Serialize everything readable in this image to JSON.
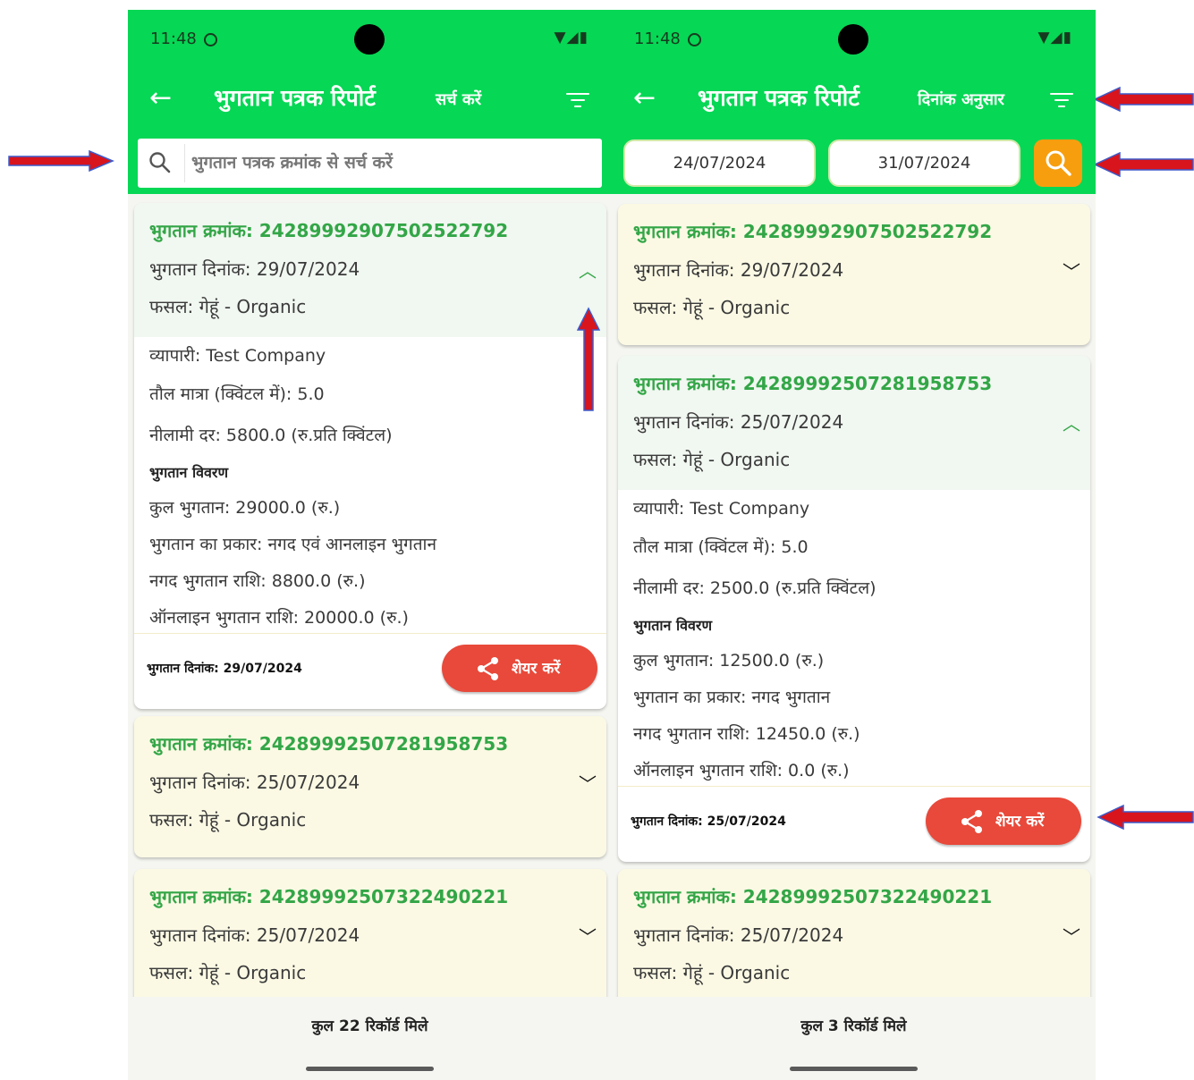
{
  "status_bar": {
    "time": "11:48",
    "icons": "▼◢▮"
  },
  "left_screen": {
    "title": "भुगतान पत्रक रिपोर्ट",
    "mode_label": "सर्च करें",
    "search_placeholder": "भुगतान पत्रक क्रमांक से सर्च करें",
    "cards": [
      {
        "id_line": "भुगतान क्रमांक: 24289992907502522792",
        "date_line": "भुगतान दिनांक: 29/07/2024",
        "crop_line": "फसल: गेहूं - Organic",
        "expanded": true,
        "details": {
          "trader": "व्यापारी: Test Company",
          "weight": "तौल मात्रा (क्विंटल में): 5.0",
          "auction_rate": "नीलामी दर: 5800.0 (रु.प्रति क्विंटल)",
          "payment_heading": "भुगतान विवरण",
          "total": "कुल भुगतान: 29000.0 (रु.)",
          "payment_type": "भुगतान का प्रकार: नगद एवं आनलाइन भुगतान",
          "cash": "नगद भुगतान राशि: 8800.0 (रु.)",
          "online": "ऑनलाइन भुगतान राशि: 20000.0 (रु.)"
        },
        "footer_date": "भुगतान दिनांक: 29/07/2024",
        "share_label": "शेयर करें"
      },
      {
        "id_line": "भुगतान क्रमांक: 24289992507281958753",
        "date_line": "भुगतान दिनांक: 25/07/2024",
        "crop_line": "फसल: गेहूं - Organic",
        "expanded": false
      },
      {
        "id_line": "भुगतान क्रमांक: 24289992507322490221",
        "date_line": "भुगतान दिनांक: 25/07/2024",
        "crop_line": "फसल: गेहूं - Organic",
        "expanded": false
      }
    ],
    "record_count": "कुल 22 रिकॉर्ड मिले"
  },
  "right_screen": {
    "title": "भुगतान पत्रक रिपोर्ट",
    "mode_label": "दिनांक अनुसार",
    "from_date": "24/07/2024",
    "to_date": "31/07/2024",
    "cards": [
      {
        "id_line": "भुगतान क्रमांक: 24289992907502522792",
        "date_line": "भुगतान दिनांक: 29/07/2024",
        "crop_line": "फसल: गेहूं - Organic",
        "expanded": false
      },
      {
        "id_line": "भुगतान क्रमांक: 24289992507281958753",
        "date_line": "भुगतान दिनांक: 25/07/2024",
        "crop_line": "फसल: गेहूं - Organic",
        "expanded": true,
        "details": {
          "trader": "व्यापारी: Test Company",
          "weight": "तौल मात्रा (क्विंटल में): 5.0",
          "auction_rate": "नीलामी दर: 2500.0 (रु.प्रति क्विंटल)",
          "payment_heading": "भुगतान विवरण",
          "total": "कुल भुगतान: 12500.0 (रु.)",
          "payment_type": "भुगतान का प्रकार: नगद भुगतान",
          "cash": "नगद भुगतान राशि: 12450.0 (रु.)",
          "online": "ऑनलाइन भुगतान राशि: 0.0 (रु.)"
        },
        "footer_date": "भुगतान दिनांक: 25/07/2024",
        "share_label": "शेयर करें"
      },
      {
        "id_line": "भुगतान क्रमांक: 24289992507322490221",
        "date_line": "भुगतान दिनांक: 25/07/2024",
        "crop_line": "फसल: गेहूं - Organic",
        "expanded": false
      }
    ],
    "record_count": "कुल 3 रिकॉर्ड मिले"
  },
  "colors": {
    "header_green": "#06d755",
    "id_green": "#33a647",
    "share_red": "#e8493a",
    "search_orange": "#f79e0f",
    "annotation_arrow": "#d8141c"
  },
  "icons": [
    "back-arrow-icon",
    "filter-icon",
    "search-icon",
    "share-icon",
    "chevron-down-icon",
    "chevron-up-icon"
  ]
}
